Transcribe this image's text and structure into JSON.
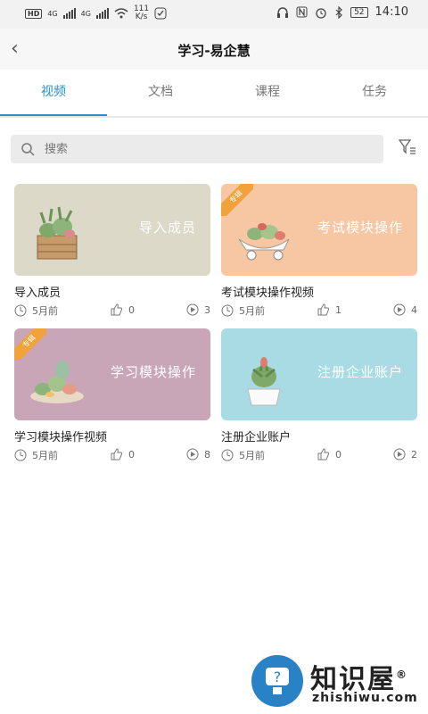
{
  "status_bar": {
    "left_badge": "HD",
    "net1": "4G",
    "net2": "4G",
    "speed_value": "111",
    "speed_unit": "K/s",
    "battery": "52",
    "time": "14:10"
  },
  "header": {
    "title": "学习-易企慧"
  },
  "tabs": [
    {
      "label": "视频",
      "active": true
    },
    {
      "label": "文档",
      "active": false
    },
    {
      "label": "课程",
      "active": false
    },
    {
      "label": "任务",
      "active": false
    }
  ],
  "search": {
    "placeholder": "搜索"
  },
  "videos": [
    {
      "thumb_label": "导入成员",
      "title": "导入成员",
      "time": "5月前",
      "likes": "0",
      "plays": "3",
      "badge": "",
      "bg": "#dcd9c8"
    },
    {
      "thumb_label": "考试模块操作",
      "title": "考试模块操作视频",
      "time": "5月前",
      "likes": "1",
      "plays": "4",
      "badge": "专辑",
      "bg": "#f7c7a4"
    },
    {
      "thumb_label": "学习模块操作",
      "title": "学习模块操作视频",
      "time": "5月前",
      "likes": "0",
      "plays": "8",
      "badge": "专辑",
      "bg": "#c9a6b7"
    },
    {
      "thumb_label": "注册企业账户",
      "title": "注册企业账户",
      "time": "5月前",
      "likes": "0",
      "plays": "2",
      "badge": "",
      "bg": "#a9dbe5"
    }
  ],
  "watermark": {
    "brand": "知识屋",
    "reg": "®",
    "url": "zhishiwu.com"
  },
  "colors": {
    "accent": "#2a90c8",
    "badge": "#f2a23a"
  }
}
